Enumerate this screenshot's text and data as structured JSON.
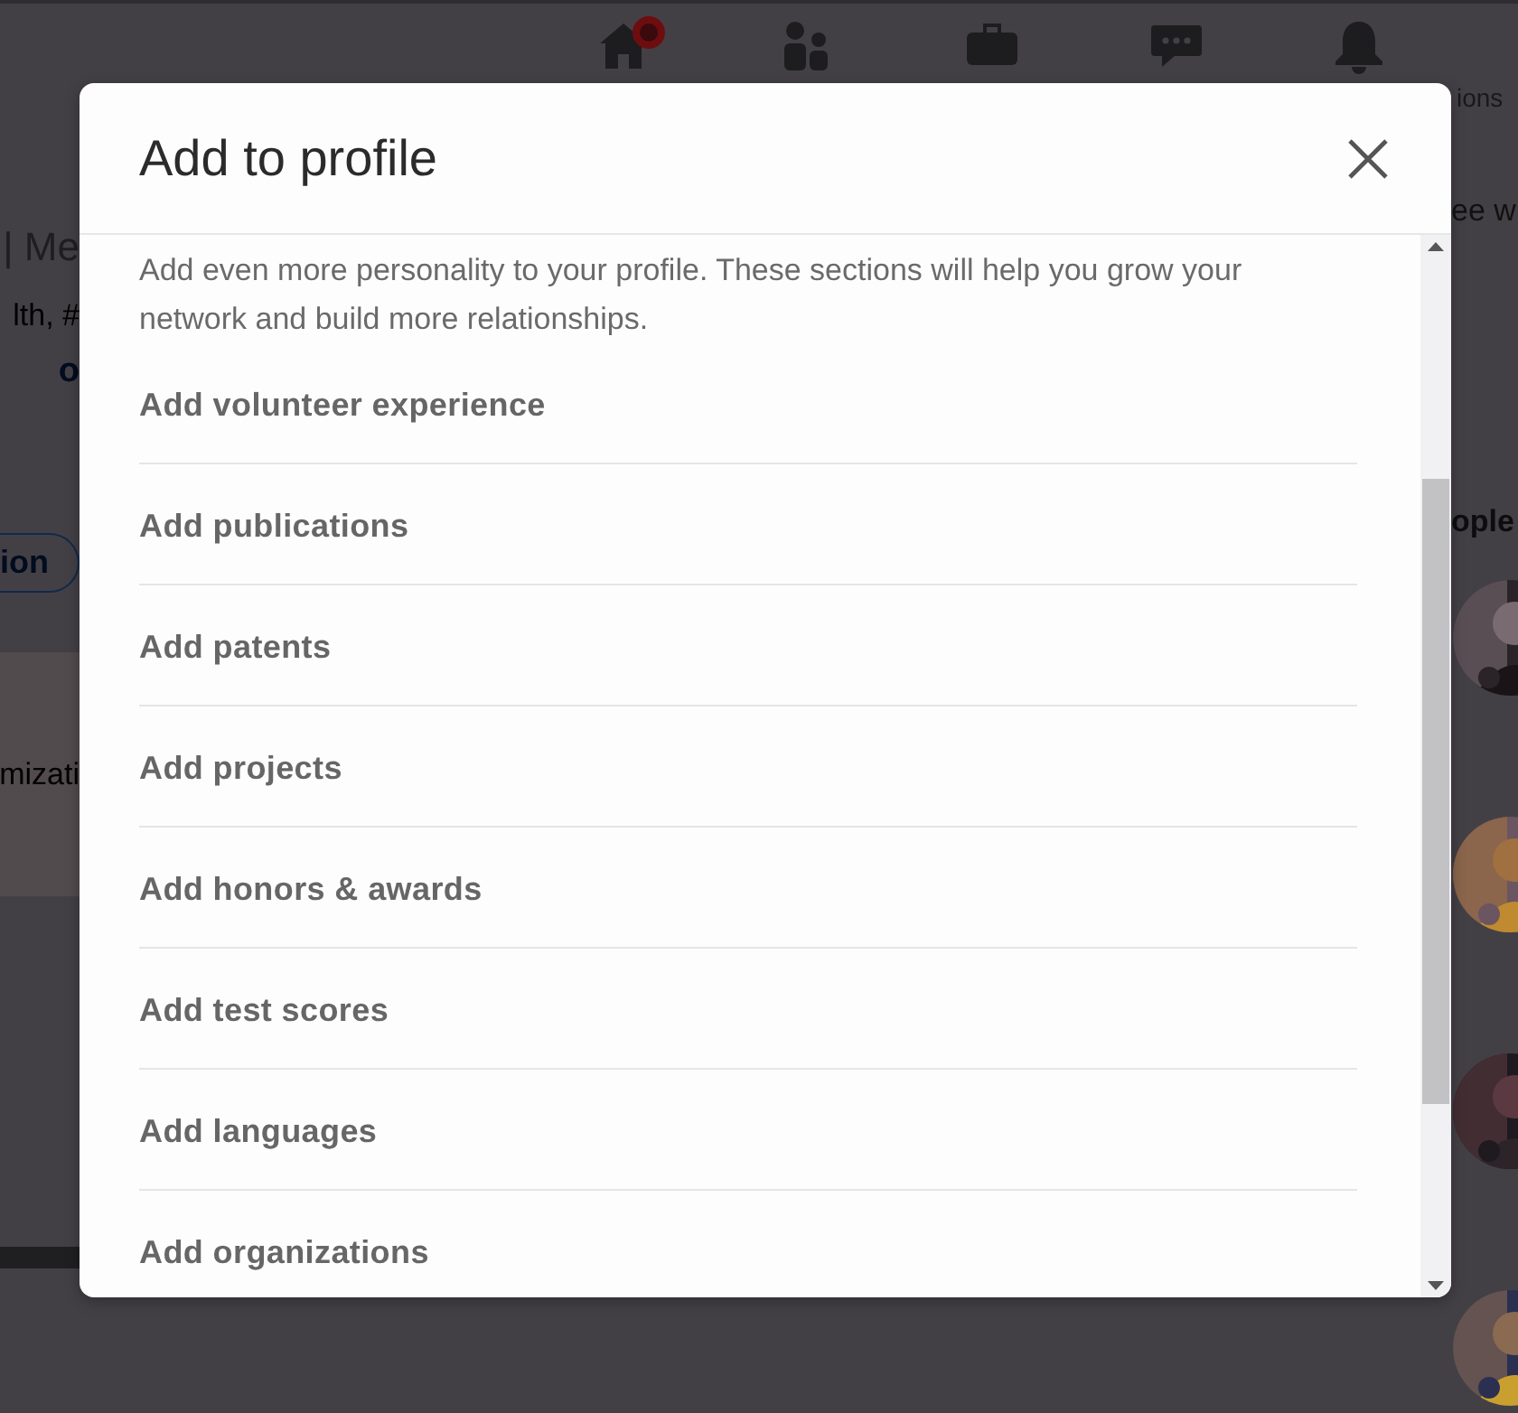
{
  "nav": {
    "items": [
      {
        "badge": true
      },
      {
        "badge": false
      },
      {
        "badge": false
      },
      {
        "badge": false
      },
      {
        "badge": false
      }
    ],
    "label": "ions"
  },
  "background": {
    "left": {
      "title": "| Me",
      "subtitle": "lth, #",
      "link": "o",
      "button": "ion",
      "card_text": "mizati"
    },
    "right": {
      "text": "ee w",
      "heading": "ople"
    }
  },
  "modal": {
    "title": "Add to profile",
    "intro": "Add even more personality to your profile. These sections will help you grow your network and build more relationships.",
    "items": [
      "Add volunteer experience",
      "Add publications",
      "Add patents",
      "Add projects",
      "Add honors & awards",
      "Add test scores",
      "Add languages",
      "Add organizations"
    ]
  }
}
